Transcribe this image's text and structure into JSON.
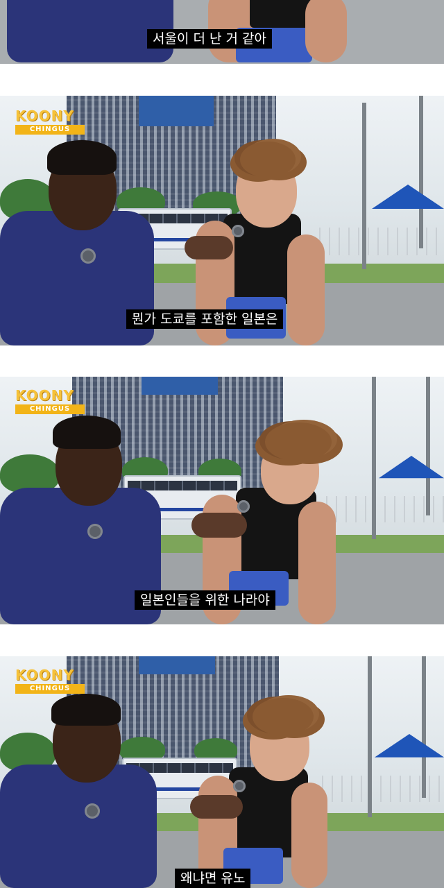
{
  "logo": {
    "main": "KOONY",
    "sub": "CHINGUS"
  },
  "frames": [
    {
      "subtitle": "서울이 더 난 거 같아"
    },
    {
      "subtitle": "뭔가 도쿄를 포함한 일본은"
    },
    {
      "subtitle": "일본인들을 위한 나라야"
    },
    {
      "subtitle": "왜냐면 유노"
    }
  ],
  "colors": {
    "background": "#ffffff",
    "subtitle_bg": "#000000",
    "subtitle_text": "#ffffff",
    "logo": "#f2b418"
  }
}
